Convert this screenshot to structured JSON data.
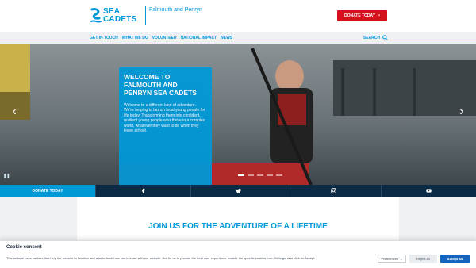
{
  "header": {
    "logo_line1": "SEA",
    "logo_line2": "CADETS",
    "unit_name": "Falmouth and Penryn",
    "donate_label": "DONATE TODAY"
  },
  "nav": {
    "items": [
      "GET IN TOUCH",
      "WHAT WE DO",
      "VOLUNTEER",
      "NATIONAL IMPACT",
      "NEWS"
    ],
    "search_label": "SEARCH"
  },
  "hero": {
    "title": "WELCOME TO FALMOUTH AND PENRYN SEA CADETS",
    "body": "Welcome to a different kind of adventure. We're helping to launch local young people for life today. Transforming them into confident, resilient young people who thrive in a complex world, whatever they want to do when they leave school.",
    "prev_icon": "chevron-left-icon",
    "next_icon": "chevron-right-icon",
    "pause_icon": "pause-icon"
  },
  "social": {
    "donate_label": "DONATE TODAY",
    "icons": [
      "facebook-icon",
      "twitter-icon",
      "instagram-icon",
      "youtube-icon"
    ]
  },
  "content": {
    "title": "JOIN US FOR THE ADVENTURE OF A LIFETIME"
  },
  "cookie": {
    "title": "Cookie consent",
    "text": "This website uses cookies that help the website to function and also to track how you interact with our website. But for us to provide the best user experience, enable the specific cookies from Settings, and click on Accept.",
    "preferences_label": "Preferences",
    "reject_label": "Reject All",
    "accept_label": "Accept All"
  },
  "colors": {
    "brand_blue": "#0099d8",
    "donate_red": "#d4101d",
    "navy": "#0b2a45",
    "accept_blue": "#1565c0"
  }
}
